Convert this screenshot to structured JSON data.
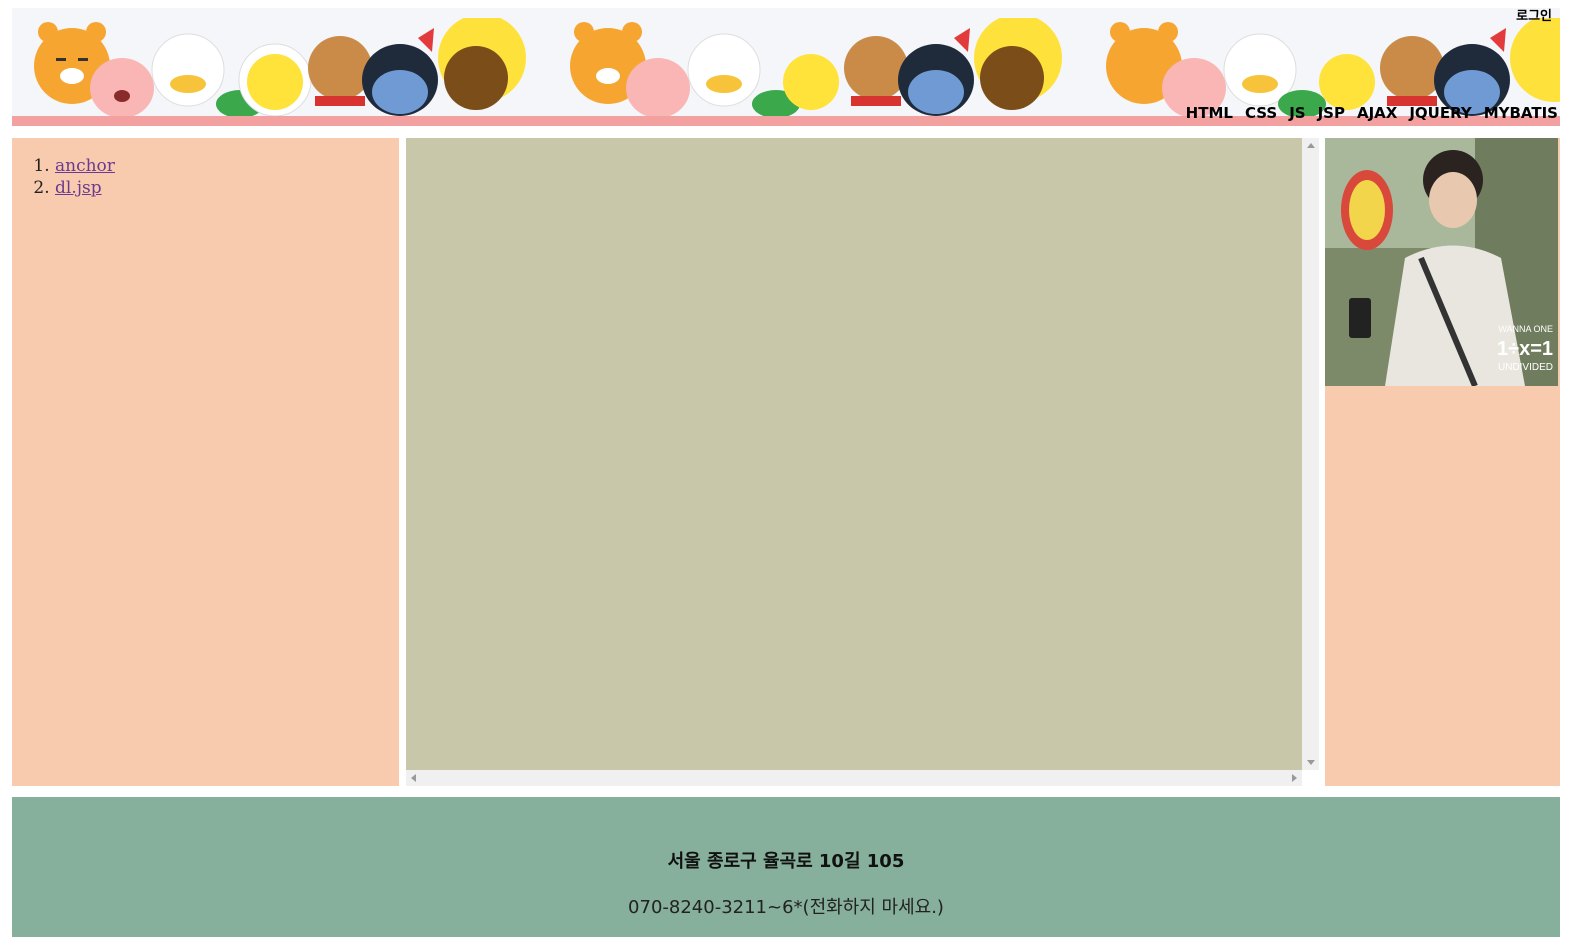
{
  "header": {
    "login_label": "로그인",
    "nav": [
      "HTML",
      "CSS",
      "JS",
      "JSP",
      "AJAX",
      "JQUERY",
      "MYBATIS"
    ],
    "banner_icon": "kakao-friends-banner-icon"
  },
  "sidebar": {
    "links": [
      {
        "label": "anchor"
      },
      {
        "label": "dl.jsp"
      }
    ]
  },
  "aside": {
    "photo_icon": "person-photo-icon",
    "photo_caption_lines": [
      "WANNA ONE",
      "1÷x=1",
      "UNDIVIDED"
    ]
  },
  "footer": {
    "address": "서울 종로구 율곡로 10길 105",
    "phone": "070-8240-3211~6*(전화하지 마세요.)"
  },
  "colors": {
    "side_bg": "#f9cbae",
    "content_bg": "#c8c7a9",
    "footer_bg": "#86af9c",
    "header_stripe": "#f2a0a0",
    "link": "#6b3a8e"
  }
}
